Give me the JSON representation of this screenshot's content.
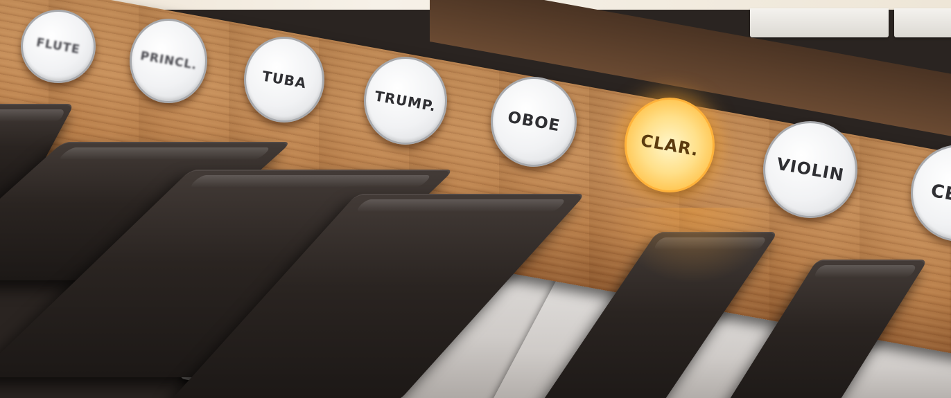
{
  "stops": [
    {
      "label": "FLUTE",
      "lit": false
    },
    {
      "label": "PRINCL.",
      "lit": false
    },
    {
      "label": "TUBA",
      "lit": false
    },
    {
      "label": "TRUMP.",
      "lit": false
    },
    {
      "label": "OBOE",
      "lit": false
    },
    {
      "label": "CLAR.",
      "lit": true
    },
    {
      "label": "VIOLIN",
      "lit": false
    },
    {
      "label": "CE",
      "lit": false
    }
  ],
  "colors": {
    "wood": "#c48d59",
    "stop_white": "#f1f2f4",
    "stop_text": "#2f2f33",
    "lit_amber": "#ffc24a",
    "black_key": "#2a2421"
  }
}
